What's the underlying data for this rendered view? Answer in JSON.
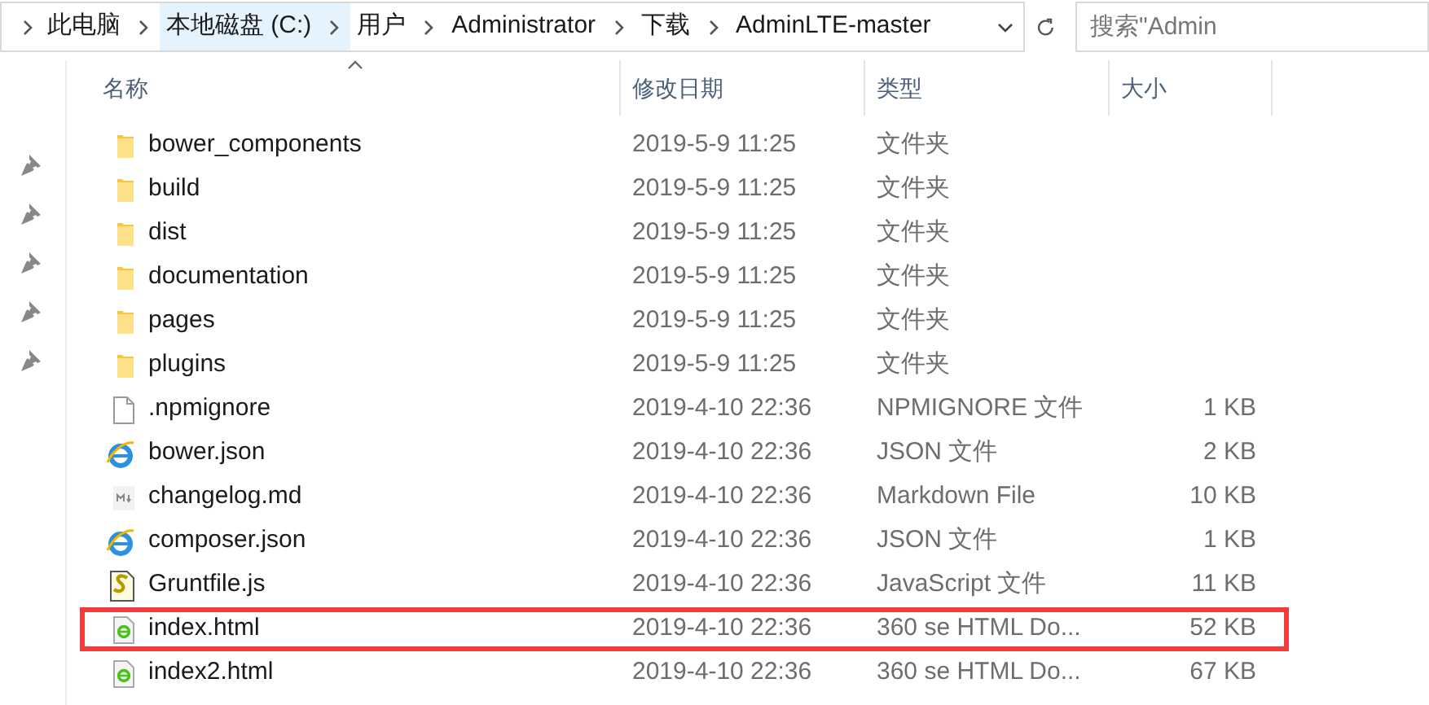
{
  "address_bar": {
    "breadcrumbs": [
      {
        "label": "此电脑",
        "selected": false
      },
      {
        "label": "本地磁盘 (C:)",
        "selected": true
      },
      {
        "label": "用户",
        "selected": false
      },
      {
        "label": "Administrator",
        "selected": false
      },
      {
        "label": "下载",
        "selected": false
      },
      {
        "label": "AdminLTE-master",
        "selected": false
      }
    ]
  },
  "search": {
    "placeholder": "搜索\"Admin"
  },
  "quick_access": {
    "pinned_count_items": [
      {
        "kind": "pin"
      },
      {
        "kind": "pin"
      },
      {
        "kind": "pin"
      },
      {
        "kind": "pin"
      },
      {
        "kind": "pin"
      }
    ]
  },
  "table": {
    "columns": [
      "名称",
      "修改日期",
      "类型",
      "大小"
    ],
    "rows": [
      {
        "kind": "folder",
        "name": "bower_components",
        "date": "2019-5-9 11:25",
        "type": "文件夹",
        "highlighted": false
      },
      {
        "kind": "folder",
        "name": "build",
        "date": "2019-5-9 11:25",
        "type": "文件夹",
        "highlighted": false
      },
      {
        "kind": "folder",
        "name": "dist",
        "date": "2019-5-9 11:25",
        "type": "文件夹",
        "highlighted": false
      },
      {
        "kind": "folder",
        "name": "documentation",
        "date": "2019-5-9 11:25",
        "type": "文件夹",
        "highlighted": false
      },
      {
        "kind": "folder",
        "name": "pages",
        "date": "2019-5-9 11:25",
        "type": "文件夹",
        "highlighted": false
      },
      {
        "kind": "folder",
        "name": "plugins",
        "date": "2019-5-9 11:25",
        "type": "文件夹",
        "highlighted": false
      },
      {
        "kind": "blank",
        "name": ".npmignore",
        "date": "2019-4-10 22:36",
        "type": "NPMIGNORE 文件",
        "size": "1 KB",
        "highlighted": false
      },
      {
        "kind": "ie",
        "name": "bower.json",
        "date": "2019-4-10 22:36",
        "type": "JSON 文件",
        "size": "2 KB",
        "highlighted": false
      },
      {
        "kind": "markdown",
        "name": "changelog.md",
        "date": "2019-4-10 22:36",
        "type": "Markdown File",
        "size": "10 KB",
        "highlighted": false
      },
      {
        "kind": "ie",
        "name": "composer.json",
        "date": "2019-4-10 22:36",
        "type": "JSON 文件",
        "size": "1 KB",
        "highlighted": false
      },
      {
        "kind": "script",
        "name": "Gruntfile.js",
        "date": "2019-4-10 22:36",
        "type": "JavaScript 文件",
        "size": "11 KB",
        "highlighted": false
      },
      {
        "kind": "html",
        "name": "index.html",
        "date": "2019-4-10 22:36",
        "type": "360 se HTML Do...",
        "size": "52 KB",
        "highlighted": true
      },
      {
        "kind": "html",
        "name": "index2.html",
        "date": "2019-4-10 22:36",
        "type": "360 se HTML Do...",
        "size": "67 KB",
        "highlighted": false
      }
    ]
  }
}
